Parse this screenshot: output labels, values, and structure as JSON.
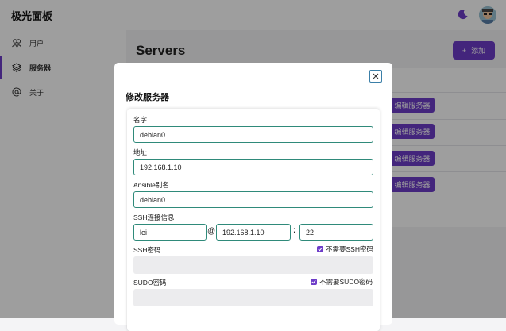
{
  "app": {
    "title": "极光面板"
  },
  "sidebar": {
    "items": [
      {
        "label": "用户"
      },
      {
        "label": "服务器"
      },
      {
        "label": "关于"
      }
    ]
  },
  "main": {
    "title": "Servers",
    "add_label": "添加",
    "edit_label": "编辑服务器"
  },
  "modal": {
    "title": "修改服务器",
    "fields": {
      "name": {
        "label": "名字",
        "value": "debian0"
      },
      "address": {
        "label": "地址",
        "value": "192.168.1.10"
      },
      "ansible_alias": {
        "label": "Ansible别名",
        "value": "debian0"
      },
      "ssh": {
        "label": "SSH连接信息",
        "user": "lei",
        "at": "@",
        "host": "192.168.1.10",
        "colon": ":",
        "port": "22"
      },
      "ssh_password": {
        "label": "SSH密码",
        "checkbox_label": "不需要SSH密码",
        "checked": true
      },
      "sudo_password": {
        "label": "SUDO密码",
        "checkbox_label": "不需要SUDO密码",
        "checked": true
      }
    }
  },
  "colors": {
    "accent": "#6d3cc8",
    "field_border": "#2f8a7a"
  }
}
